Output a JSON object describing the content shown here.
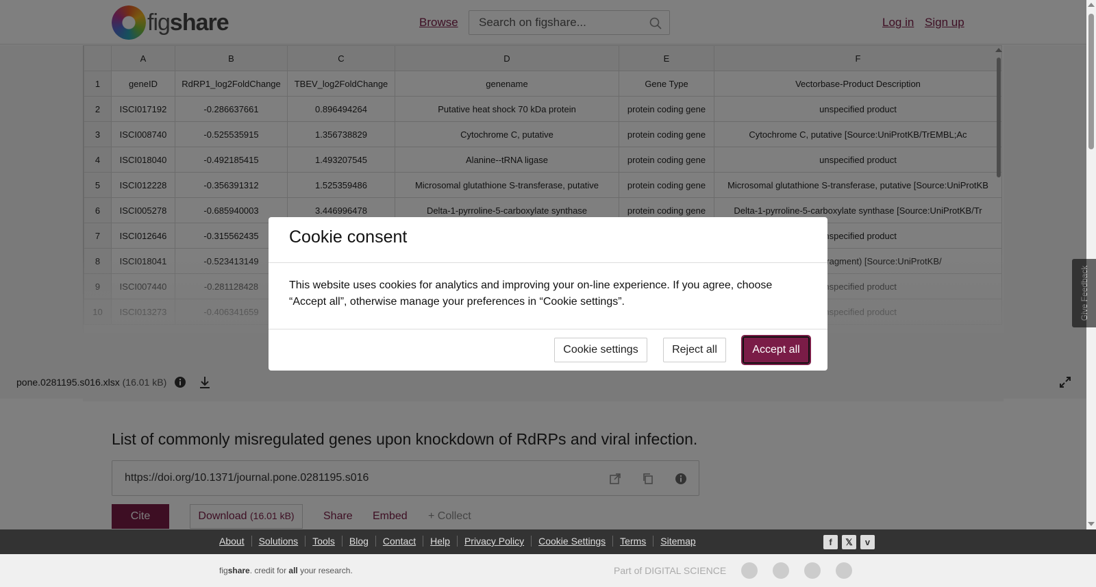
{
  "brand": {
    "name_light": "fig",
    "name_bold": "share"
  },
  "header": {
    "browse": "Browse",
    "search_placeholder": "Search on figshare...",
    "login": "Log in",
    "signup": "Sign up"
  },
  "sheet": {
    "columns": [
      "A",
      "B",
      "C",
      "D",
      "E",
      "F"
    ],
    "rows": [
      {
        "num": "1",
        "cells": [
          "geneID",
          "RdRP1_log2FoldChange",
          "TBEV_log2FoldChange",
          "genename",
          "Gene Type",
          "Vectorbase-Product Description"
        ]
      },
      {
        "num": "2",
        "cells": [
          "ISCI017192",
          "-0.286637661",
          "0.896494264",
          "Putative heat shock 70 kDa protein",
          "protein coding gene",
          "unspecified product"
        ]
      },
      {
        "num": "3",
        "cells": [
          "ISCI008740",
          "-0.525535915",
          "1.356738829",
          "Cytochrome C, putative",
          "protein coding gene",
          "Cytochrome C, putative [Source:UniProtKB/TrEMBL;Ac"
        ]
      },
      {
        "num": "4",
        "cells": [
          "ISCI018040",
          "-0.492185415",
          "1.493207545",
          "Alanine--tRNA ligase",
          "protein coding gene",
          "unspecified product"
        ]
      },
      {
        "num": "5",
        "cells": [
          "ISCI012228",
          "-0.356391312",
          "1.525359486",
          "Microsomal glutathione S-transferase, putative",
          "protein coding gene",
          "Microsomal glutathione S-transferase, putative [Source:UniProtKB"
        ]
      },
      {
        "num": "6",
        "cells": [
          "ISCI005278",
          "-0.685940003",
          "3.446996478",
          "Delta-1-pyrroline-5-carboxylate synthase",
          "protein coding gene",
          "Delta-1-pyrroline-5-carboxylate synthase [Source:UniProtKB/Tr"
        ]
      },
      {
        "num": "7",
        "cells": [
          "ISCI012646",
          "-0.315562435",
          "",
          "",
          "",
          "unspecified product"
        ]
      },
      {
        "num": "8",
        "cells": [
          "ISCI018041",
          "-0.523413149",
          "",
          "",
          "",
          "e, putative (Fragment) [Source:UniProtKB/"
        ]
      },
      {
        "num": "9",
        "cells": [
          "ISCI007440",
          "-0.281128428",
          "",
          "",
          "",
          "unspecified product"
        ]
      },
      {
        "num": "10",
        "cells": [
          "ISCI013273",
          "-0.406341659",
          "",
          "",
          "",
          "unspecified product"
        ]
      }
    ]
  },
  "file": {
    "name": "pone.0281195.s016.xlsx",
    "size": "(16.01 kB)"
  },
  "item": {
    "title": "List of commonly misregulated genes upon knockdown of RdRPs and viral infection.",
    "doi": "https://doi.org/10.1371/journal.pone.0281195.s016",
    "cite": "Cite",
    "download": "Download",
    "download_size": "(16.01 kB)",
    "share": "Share",
    "embed": "Embed",
    "collect": "+ Collect"
  },
  "footer": {
    "links": [
      "About",
      "Solutions",
      "Tools",
      "Blog",
      "Contact",
      "Help",
      "Privacy Policy",
      "Cookie Settings",
      "Terms",
      "Sitemap"
    ],
    "tagline_fig": "fig",
    "tagline_share": "share",
    "tagline_mid": ". credit for ",
    "tagline_all": "all",
    "tagline_end": " your research.",
    "partner_ds": "Part of DIGITAL SCIENCE"
  },
  "feedback": "Give Feedback",
  "cookie": {
    "title": "Cookie consent",
    "body": "This website uses cookies for analytics and improving your on-line experience. If you agree, choose “Accept all”, otherwise manage your preferences in “Cookie settings”.",
    "settings": "Cookie settings",
    "reject": "Reject all",
    "accept": "Accept all"
  },
  "colors": {
    "brand": "#7a1c47",
    "footer_bg": "#333333",
    "overlay": "rgba(0,0,0,0.5)"
  }
}
